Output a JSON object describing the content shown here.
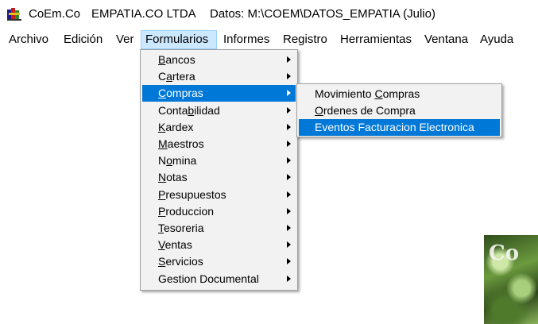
{
  "titlebar": {
    "app_name": "CoEm.Co",
    "company": "EMPATIA.CO LTDA",
    "data_path": "Datos: M:\\COEM\\DATOS_EMPATIA  (Julio)"
  },
  "menubar": {
    "items": [
      "Archivo",
      "Edición",
      "Ver",
      "Formularios",
      "Informes",
      "Registro",
      "Herramientas",
      "Ventana",
      "Ayuda"
    ],
    "active": "Formularios"
  },
  "formularios_menu": {
    "items": [
      {
        "pre": "",
        "key": "B",
        "post": "ancos"
      },
      {
        "pre": "C",
        "key": "a",
        "post": "rtera"
      },
      {
        "pre": "",
        "key": "C",
        "post": "ompras"
      },
      {
        "pre": "Conta",
        "key": "b",
        "post": "ilidad"
      },
      {
        "pre": "",
        "key": "K",
        "post": "ardex"
      },
      {
        "pre": "",
        "key": "M",
        "post": "aestros"
      },
      {
        "pre": "N",
        "key": "o",
        "post": "mina"
      },
      {
        "pre": "",
        "key": "N",
        "post": "otas"
      },
      {
        "pre": "",
        "key": "P",
        "post": "resupuestos"
      },
      {
        "pre": "",
        "key": "P",
        "post": "roduccion"
      },
      {
        "pre": "",
        "key": "T",
        "post": "esoreria"
      },
      {
        "pre": "",
        "key": "V",
        "post": "entas"
      },
      {
        "pre": "",
        "key": "S",
        "post": "ervicios"
      },
      {
        "pre": "Gestion Documental",
        "key": "",
        "post": ""
      }
    ],
    "highlighted_index": 2
  },
  "compras_menu": {
    "items": [
      {
        "pre": "Movimiento ",
        "key": "C",
        "post": "ompras"
      },
      {
        "pre": "",
        "key": "O",
        "post": "rdenes de Compra"
      },
      {
        "pre": "Eventos Facturacion Electronica",
        "key": "",
        "post": ""
      }
    ],
    "highlighted_index": 2
  },
  "background": {
    "logo_fragment": "Co"
  },
  "colors": {
    "highlight": "#0078d7",
    "active_menu": "#cce8ff",
    "menu_bg": "#f2f2f2"
  }
}
